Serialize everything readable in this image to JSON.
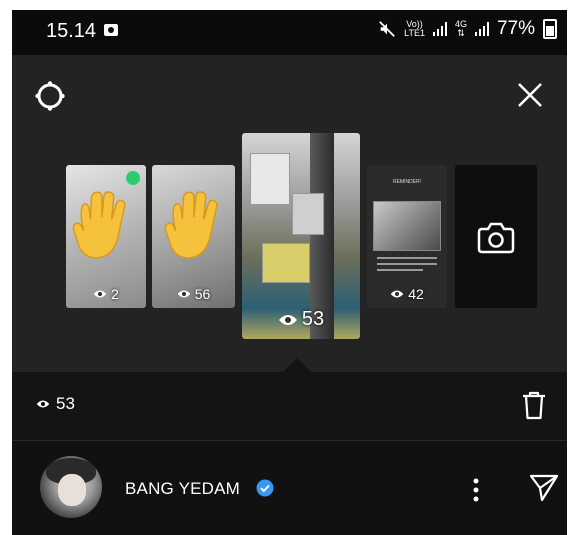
{
  "status_bar": {
    "time": "15.14",
    "volte_label": "Vo))",
    "lte_label": "LTE1",
    "network_4g_label": "4G",
    "battery": "77%"
  },
  "icons": {
    "settings": "gear-icon",
    "close": "close-icon",
    "camera": "camera-icon",
    "trash": "trash-icon",
    "more": "more-vertical-icon",
    "send": "send-icon",
    "verified": "verified-badge-icon",
    "eye": "eye-icon"
  },
  "stories": [
    {
      "views": "2"
    },
    {
      "views": "56"
    },
    {
      "views": "53"
    },
    {
      "views": "42"
    }
  ],
  "story_preview_text": {
    "header": "REMINDER!"
  },
  "current": {
    "views": "53"
  },
  "profile": {
    "username": "BANG YEDAM"
  },
  "colors": {
    "background": "#111111",
    "viewer_bg": "#232323",
    "verified_blue": "#3897f0",
    "badge_green": "#2ecc71",
    "hand_yellow": "#f7c23b"
  }
}
